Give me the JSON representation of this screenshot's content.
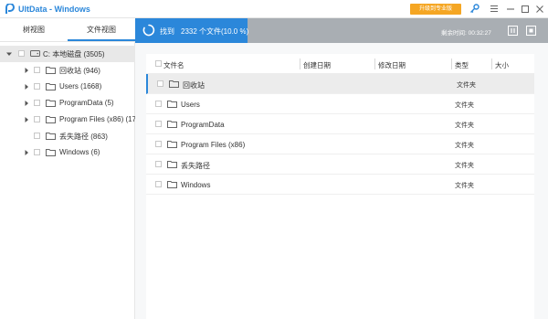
{
  "app": {
    "title": "UltData - Windows",
    "upgrade_label": "升级到专业版"
  },
  "colors": {
    "accent": "#2b87da",
    "upgrade": "#f5a623",
    "topbar_gray": "#a9aeb3"
  },
  "left": {
    "tabs": [
      {
        "label": "树视图"
      },
      {
        "label": "文件视图"
      }
    ],
    "root": {
      "label": "C: 本地磁盘 (3505)"
    },
    "items": [
      {
        "label": "回收站 (946)",
        "expandable": true
      },
      {
        "label": "Users (1668)",
        "expandable": true
      },
      {
        "label": "ProgramData (5)",
        "expandable": true
      },
      {
        "label": "Program Files (x86) (17",
        "expandable": true
      },
      {
        "label": "丢失路径 (863)",
        "expandable": false
      },
      {
        "label": "Windows (6)",
        "expandable": true
      }
    ]
  },
  "scan": {
    "found_label": "找到",
    "found_count": "2332 个文件(10.0 %)",
    "remaining": "剩余时间: 00:32:27"
  },
  "table": {
    "headers": {
      "name": "文件名",
      "created": "创建日期",
      "modified": "修改日期",
      "type": "类型",
      "size": "大小"
    },
    "rows": [
      {
        "name": "回收站",
        "type": "文件夹"
      },
      {
        "name": "Users",
        "type": "文件夹"
      },
      {
        "name": "ProgramData",
        "type": "文件夹"
      },
      {
        "name": "Program Files (x86)",
        "type": "文件夹"
      },
      {
        "name": "丢失路径",
        "type": "文件夹"
      },
      {
        "name": "Windows",
        "type": "文件夹"
      }
    ]
  }
}
